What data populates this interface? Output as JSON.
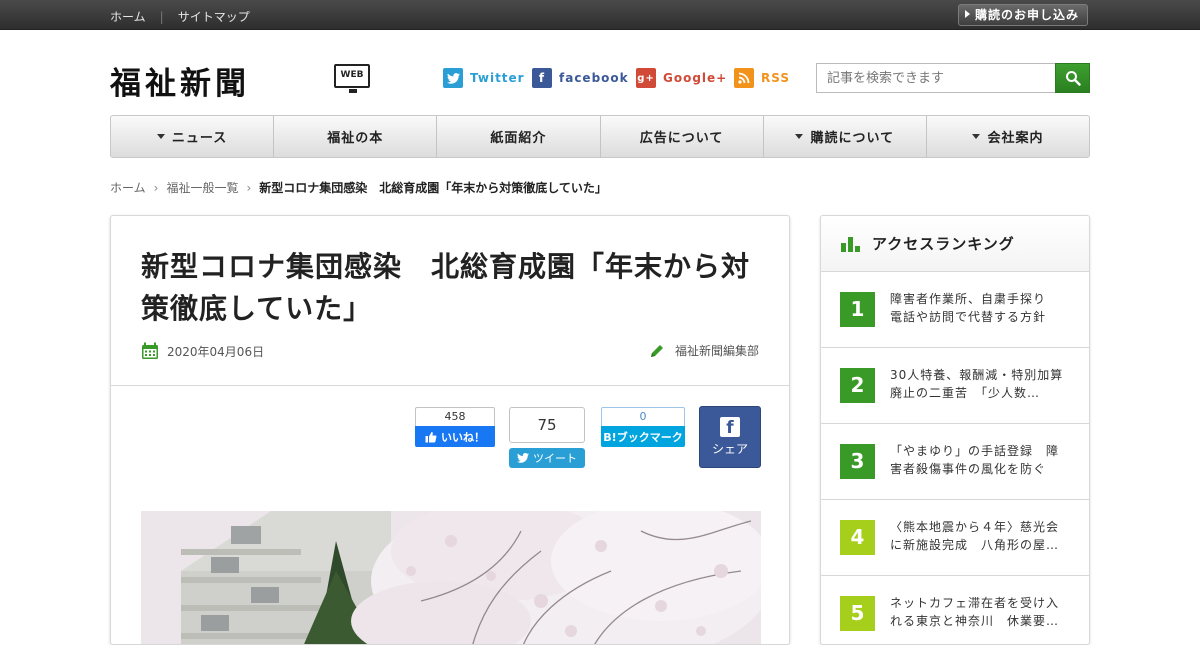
{
  "topbar": {
    "home": "ホーム",
    "sitemap": "サイトマップ",
    "subscribe": "購読のお申し込み"
  },
  "header": {
    "logo": "福祉新聞",
    "logo_badge": "WEB",
    "social": {
      "twitter": "Twitter",
      "facebook": "facebook",
      "google": "Google+",
      "rss": "RSS"
    },
    "search": {
      "placeholder": "記事を検索できます"
    }
  },
  "nav": {
    "items": [
      {
        "label": "ニュース",
        "dropdown": true
      },
      {
        "label": "福祉の本",
        "dropdown": false
      },
      {
        "label": "紙面紹介",
        "dropdown": false
      },
      {
        "label": "広告について",
        "dropdown": false
      },
      {
        "label": "購読について",
        "dropdown": true
      },
      {
        "label": "会社案内",
        "dropdown": true
      }
    ]
  },
  "breadcrumb": {
    "home": "ホーム",
    "category": "福祉一般一覧",
    "current": "新型コロナ集団感染　北総育成園「年末から対策徹底していた」"
  },
  "article": {
    "title": "新型コロナ集団感染　北総育成園「年末から対策徹底していた」",
    "date": "2020年04月06日",
    "author": "福祉新聞編集部",
    "share": {
      "like_count": "458",
      "like_label": "いいね！",
      "tweet_count": "75",
      "tweet_label": "ツイート",
      "hatena_count": "0",
      "hatena_label": "B!ブックマーク",
      "fb_label": "シェア"
    }
  },
  "sidebar": {
    "title": "アクセスランキング",
    "items": [
      {
        "rank": "1",
        "title": "障害者作業所、自粛手探り　電話や訪問で代替する方針",
        "color": "#3a9a28"
      },
      {
        "rank": "2",
        "title": "30人特養、報酬減・特別加算廃止の二重苦　「少人数…",
        "color": "#3a9a28"
      },
      {
        "rank": "3",
        "title": "「やまゆり」の手話登録　障害者殺傷事件の風化を防ぐ",
        "color": "#3a9a28"
      },
      {
        "rank": "4",
        "title": "〈熊本地震から４年〉慈光会に新施設完成　八角形の屋…",
        "color": "#a5cf1a"
      },
      {
        "rank": "5",
        "title": "ネットカフェ滞在者を受け入れる東京と神奈川　休業要…",
        "color": "#a5cf1a"
      }
    ]
  },
  "colors": {
    "accent_green": "#3a9a28",
    "rank_light_green": "#a5cf1a",
    "twitter": "#2a9fd6",
    "facebook": "#3b5998",
    "google": "#d04a37",
    "rss": "#f3921b"
  }
}
